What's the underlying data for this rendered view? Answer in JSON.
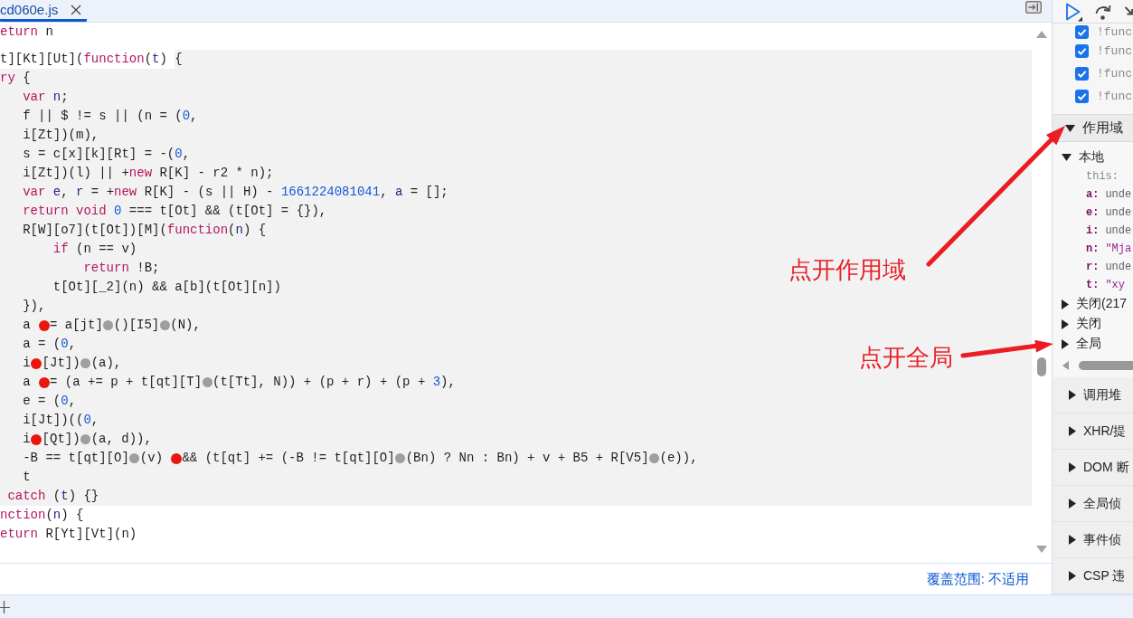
{
  "editor": {
    "tabs": [
      {
        "label": "cd060e.js",
        "selected": true
      }
    ],
    "lines": [
      {
        "kind": "plain",
        "segments": [
          {
            "text": "eturn",
            "kind": "keyword"
          },
          {
            "text": " n",
            "kind": "plain"
          }
        ]
      },
      {
        "kind": "highlight_start",
        "segments": [
          {
            "text": "t][Kt][Ut](",
            "kind": "plain"
          },
          {
            "text": "function",
            "kind": "keyword"
          },
          {
            "text": "(",
            "kind": "plain"
          },
          {
            "text": "t",
            "kind": "definition"
          },
          {
            "text": ") ",
            "kind": "plain"
          },
          {
            "text": "{",
            "kind": "plain"
          }
        ]
      },
      {
        "kind": "highlighted",
        "segments": [
          {
            "text": "ry",
            "kind": "keyword"
          },
          {
            "text": " {",
            "kind": "plain"
          }
        ]
      },
      {
        "kind": "highlighted",
        "segments": [
          {
            "text": "   var ",
            "kind": "keyword"
          },
          {
            "text": "n",
            "kind": "definition"
          },
          {
            "text": ";",
            "kind": "plain"
          }
        ]
      },
      {
        "kind": "highlighted",
        "segments": [
          {
            "text": "   f || $ != s || (n = (",
            "kind": "plain"
          },
          {
            "text": "0",
            "kind": "number"
          },
          {
            "text": ",",
            "kind": "plain"
          }
        ]
      },
      {
        "kind": "highlighted",
        "segments": [
          {
            "text": "   i[Zt])(m),",
            "kind": "plain"
          }
        ]
      },
      {
        "kind": "highlighted",
        "segments": [
          {
            "text": "   s = c[x][k][Rt] = -(",
            "kind": "plain"
          },
          {
            "text": "0",
            "kind": "number"
          },
          {
            "text": ",",
            "kind": "plain"
          }
        ]
      },
      {
        "kind": "highlighted",
        "segments": [
          {
            "text": "   i[Zt])(l) || +",
            "kind": "plain"
          },
          {
            "text": "new",
            "kind": "keyword"
          },
          {
            "text": " R[K] - r2 * n);",
            "kind": "plain"
          }
        ]
      },
      {
        "kind": "highlighted",
        "segments": [
          {
            "text": "   var ",
            "kind": "keyword"
          },
          {
            "text": "e",
            "kind": "definition"
          },
          {
            "text": ", ",
            "kind": "plain"
          },
          {
            "text": "r",
            "kind": "definition"
          },
          {
            "text": " = +",
            "kind": "plain"
          },
          {
            "text": "new",
            "kind": "keyword"
          },
          {
            "text": " R[K] - (s || H) - ",
            "kind": "plain"
          },
          {
            "text": "1661224081041",
            "kind": "number"
          },
          {
            "text": ", ",
            "kind": "plain"
          },
          {
            "text": "a",
            "kind": "definition"
          },
          {
            "text": " = [];",
            "kind": "plain"
          }
        ]
      },
      {
        "kind": "highlighted",
        "segments": [
          {
            "text": "   return void ",
            "kind": "keyword"
          },
          {
            "text": "0",
            "kind": "number"
          },
          {
            "text": " === t[Ot] && (t[Ot] = {}),",
            "kind": "plain"
          }
        ]
      },
      {
        "kind": "highlighted",
        "segments": [
          {
            "text": "   R[W][o7](t[Ot])[M](",
            "kind": "plain"
          },
          {
            "text": "function",
            "kind": "keyword"
          },
          {
            "text": "(",
            "kind": "plain"
          },
          {
            "text": "n",
            "kind": "definition"
          },
          {
            "text": ") {",
            "kind": "plain"
          }
        ]
      },
      {
        "kind": "highlighted",
        "segments": [
          {
            "text": "       if",
            "kind": "keyword"
          },
          {
            "text": " (n == v)",
            "kind": "plain"
          }
        ]
      },
      {
        "kind": "highlighted",
        "segments": [
          {
            "text": "           return",
            "kind": "keyword"
          },
          {
            "text": " !B;",
            "kind": "plain"
          }
        ]
      },
      {
        "kind": "highlighted",
        "segments": [
          {
            "text": "       t[Ot][_2](n) && a[b](t[Ot][n])",
            "kind": "plain"
          }
        ]
      },
      {
        "kind": "highlighted",
        "segments": [
          {
            "text": "   }),",
            "kind": "plain"
          }
        ]
      },
      {
        "kind": "highlighted",
        "segments": [
          {
            "text": "   a ",
            "kind": "plain"
          },
          {
            "kind": "breakpoint",
            "active": true
          },
          {
            "text": "= a[jt]",
            "kind": "plain"
          },
          {
            "kind": "breakpoint",
            "active": false
          },
          {
            "text": "()[I5]",
            "kind": "plain"
          },
          {
            "kind": "breakpoint",
            "active": false
          },
          {
            "text": "(N),",
            "kind": "plain"
          }
        ]
      },
      {
        "kind": "highlighted",
        "segments": [
          {
            "text": "   a = (",
            "kind": "plain"
          },
          {
            "text": "0",
            "kind": "number"
          },
          {
            "text": ",",
            "kind": "plain"
          }
        ]
      },
      {
        "kind": "highlighted",
        "segments": [
          {
            "text": "   i",
            "kind": "plain"
          },
          {
            "kind": "breakpoint",
            "active": true
          },
          {
            "text": "[Jt])",
            "kind": "plain"
          },
          {
            "kind": "breakpoint",
            "active": false
          },
          {
            "text": "(a),",
            "kind": "plain"
          }
        ]
      },
      {
        "kind": "highlighted",
        "segments": [
          {
            "text": "   a ",
            "kind": "plain"
          },
          {
            "kind": "breakpoint",
            "active": true
          },
          {
            "text": "= (a += p + t[qt][T]",
            "kind": "plain"
          },
          {
            "kind": "breakpoint",
            "active": false
          },
          {
            "text": "(t[Tt], N)) + (p + r) + (p + ",
            "kind": "plain"
          },
          {
            "text": "3",
            "kind": "number"
          },
          {
            "text": "),",
            "kind": "plain"
          }
        ]
      },
      {
        "kind": "highlighted",
        "segments": [
          {
            "text": "   e = (",
            "kind": "plain"
          },
          {
            "text": "0",
            "kind": "number"
          },
          {
            "text": ",",
            "kind": "plain"
          }
        ]
      },
      {
        "kind": "highlighted",
        "segments": [
          {
            "text": "   i[Jt])((",
            "kind": "plain"
          },
          {
            "text": "0",
            "kind": "number"
          },
          {
            "text": ",",
            "kind": "plain"
          }
        ]
      },
      {
        "kind": "highlighted",
        "segments": [
          {
            "text": "   i",
            "kind": "plain"
          },
          {
            "kind": "breakpoint",
            "active": true
          },
          {
            "text": "[Qt])",
            "kind": "plain"
          },
          {
            "kind": "breakpoint",
            "active": false
          },
          {
            "text": "(a, d)),",
            "kind": "plain"
          }
        ]
      },
      {
        "kind": "highlighted",
        "segments": [
          {
            "text": "   -B == t[qt][O]",
            "kind": "plain"
          },
          {
            "kind": "breakpoint",
            "active": false
          },
          {
            "text": "(v) ",
            "kind": "plain"
          },
          {
            "kind": "breakpoint",
            "active": true
          },
          {
            "text": "&& (t[qt] += (-B != t[qt][O]",
            "kind": "plain"
          },
          {
            "kind": "breakpoint",
            "active": false
          },
          {
            "text": "(Bn) ? Nn : Bn) + v + B5 + R[V5]",
            "kind": "plain"
          },
          {
            "kind": "breakpoint",
            "active": false
          },
          {
            "text": "(e)),",
            "kind": "plain"
          }
        ]
      },
      {
        "kind": "highlighted",
        "segments": [
          {
            "text": "   t",
            "kind": "plain"
          }
        ]
      },
      {
        "kind": "highlighted",
        "segments": [
          {
            "text": " catch",
            "kind": "keyword"
          },
          {
            "text": " (",
            "kind": "plain"
          },
          {
            "text": "t",
            "kind": "definition"
          },
          {
            "text": ") {}",
            "kind": "plain"
          }
        ]
      },
      {
        "kind": "plain",
        "segments": [
          {
            "text": "nction",
            "kind": "keyword"
          },
          {
            "text": "(",
            "kind": "plain"
          },
          {
            "text": "n",
            "kind": "definition"
          },
          {
            "text": ") {",
            "kind": "plain"
          }
        ]
      },
      {
        "kind": "plain",
        "segments": [
          {
            "text": "eturn",
            "kind": "keyword"
          },
          {
            "text": " R[Yt][Vt](n)",
            "kind": "plain"
          }
        ]
      }
    ],
    "status": {
      "coverage": "覆盖范围: 不适用"
    }
  },
  "debugger": {
    "breakpoints": [
      {
        "label": "!func",
        "checked": true
      },
      {
        "label": "!func",
        "checked": true
      },
      {
        "label": "!func",
        "checked": true
      },
      {
        "label": "!func",
        "checked": true
      }
    ],
    "scope": {
      "title": "作用域",
      "expanded": true,
      "groups": [
        {
          "label": "本地",
          "expanded": true,
          "children": [
            {
              "key": "this:",
              "kind": "special"
            },
            {
              "key": "a:",
              "value": "unde",
              "kind": "undefined"
            },
            {
              "key": "e:",
              "value": "unde",
              "kind": "undefined"
            },
            {
              "key": "i:",
              "value": "unde",
              "kind": "undefined"
            },
            {
              "key": "n:",
              "value": "\"Mja",
              "kind": "string"
            },
            {
              "key": "r:",
              "value": "unde",
              "kind": "undefined"
            },
            {
              "key": "t:",
              "value": "\"xy",
              "kind": "string"
            }
          ]
        },
        {
          "label": "关闭(217",
          "expanded": false
        },
        {
          "label": "关闭",
          "expanded": false
        },
        {
          "label": "全局",
          "expanded": false
        }
      ]
    },
    "sections": [
      {
        "title": "调用堆",
        "expanded": false
      },
      {
        "title": "XHR/提",
        "expanded": false
      },
      {
        "title": "DOM 断",
        "expanded": false
      },
      {
        "title": "全局侦",
        "expanded": false
      },
      {
        "title": "事件侦",
        "expanded": false
      },
      {
        "title": "CSP 违",
        "expanded": false
      }
    ]
  },
  "annotations": [
    {
      "text": "点开作用域"
    },
    {
      "text": "点开全局"
    }
  ]
}
